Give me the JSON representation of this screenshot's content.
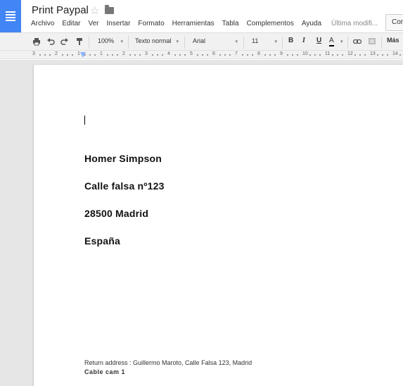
{
  "header": {
    "title": "Print Paypal",
    "menu": [
      "Archivo",
      "Editar",
      "Ver",
      "Insertar",
      "Formato",
      "Herramientas",
      "Tabla",
      "Complementos",
      "Ayuda"
    ],
    "last_edit": "Última modifi...",
    "comments_label": "Com"
  },
  "toolbar": {
    "zoom": "100%",
    "style": "Texto normal",
    "font": "Arial",
    "size": "11",
    "more": "Más"
  },
  "ruler": {
    "numbers": [
      "3",
      "2",
      "1",
      "1",
      "2",
      "3",
      "4",
      "5",
      "6",
      "7",
      "8",
      "9",
      "10",
      "11",
      "12",
      "13",
      "14"
    ]
  },
  "document": {
    "lines": [
      "Homer Simpson",
      "Calle falsa nº123",
      "28500 Madrid",
      "España"
    ],
    "return_address": "Return address : Guillermo Maroto, Calle Falsa 123, Madrid",
    "footer_bold": "Cable cam 1"
  },
  "colors": {
    "accent": "#4285f4",
    "toolbar_bg": "#f1f1f1",
    "canvas_bg": "#e6e6e6"
  }
}
